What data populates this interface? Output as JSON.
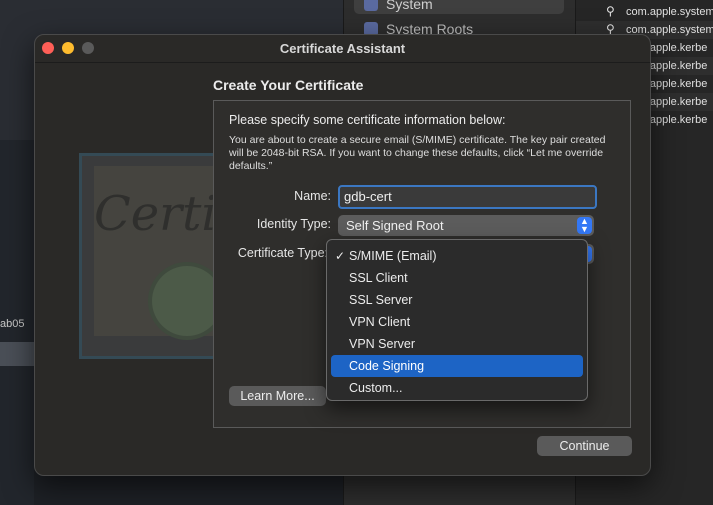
{
  "window": {
    "title": "Certificate Assistant",
    "heading": "Create Your Certificate"
  },
  "form": {
    "intro": "Please specify some certificate information below:",
    "description": "You are about to create a secure email (S/MIME) certificate. The key pair created will be 2048-bit RSA. If you want to change these defaults, click “Let me override defaults.”",
    "name_label": "Name:",
    "name_value": "gdb-cert",
    "identity_type_label": "Identity Type:",
    "identity_type_value": "Self Signed Root",
    "certificate_type_label": "Certificate Type:",
    "learn_more_label": "Learn More...",
    "continue_label": "Continue"
  },
  "certificate_type_menu": {
    "items": [
      {
        "label": "S/MIME (Email)",
        "checked": "✓"
      },
      {
        "label": "SSL Client"
      },
      {
        "label": "SSL Server"
      },
      {
        "label": "VPN Client"
      },
      {
        "label": "VPN Server"
      },
      {
        "label": "Code Signing"
      },
      {
        "label": "Custom..."
      }
    ],
    "highlighted_index": 5
  },
  "background": {
    "sidebar_items": [
      "System",
      "System Roots"
    ],
    "left_tab": "ab05",
    "artwork_text": "Certifi",
    "list_rows": [
      "com.apple.system",
      "com.apple.system",
      "com.apple.kerbe",
      "com.apple.kerbe",
      "com.apple.kerbe",
      "com.apple.kerbe",
      "com.apple.kerbe"
    ]
  },
  "colors": {
    "accent": "#3478f6",
    "highlight": "#1d64c5",
    "close": "#ff5f57",
    "minimize": "#febc2e"
  }
}
